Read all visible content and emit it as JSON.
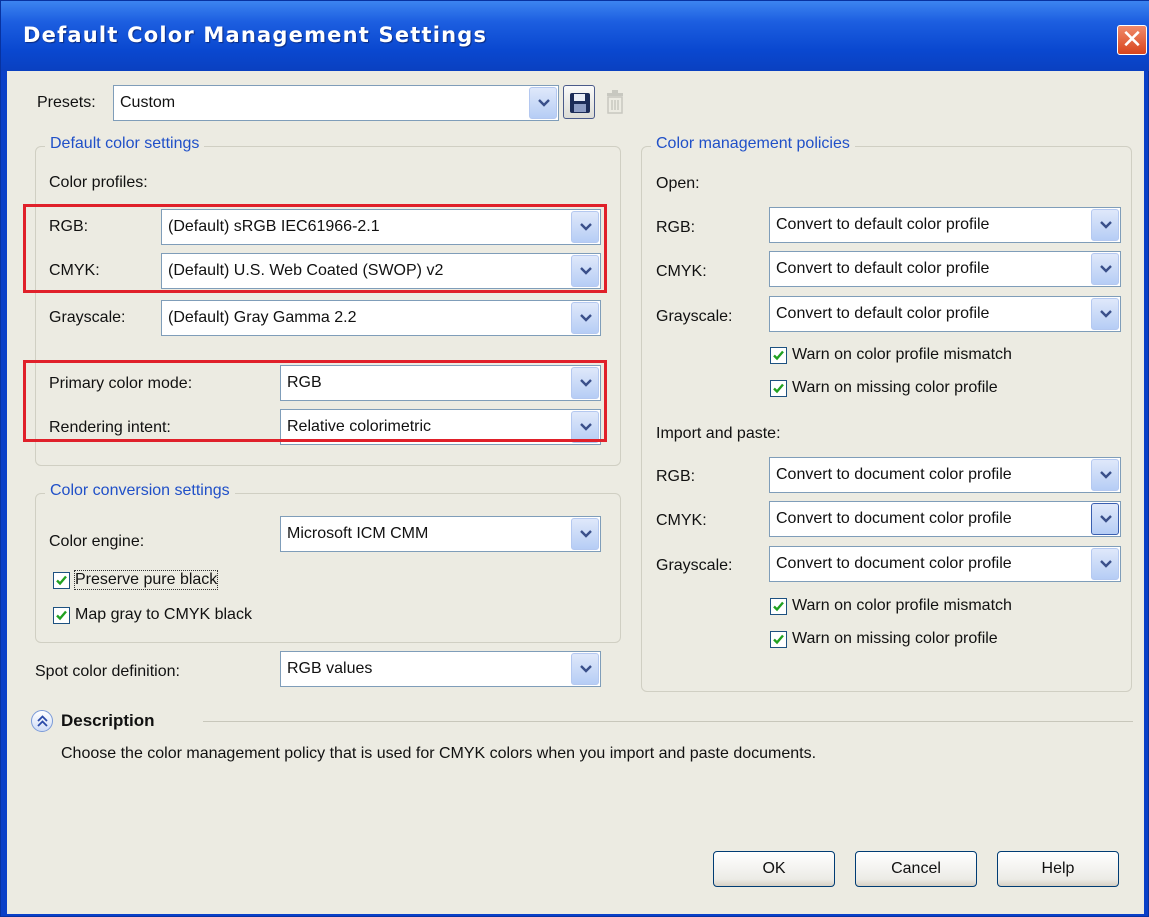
{
  "window": {
    "title": "Default Color Management Settings",
    "close_glyph": "✕"
  },
  "presets": {
    "label": "Presets:",
    "value": "Custom",
    "save_icon": "save-icon",
    "delete_icon": "trash-icon"
  },
  "default_color": {
    "legend": "Default color settings",
    "profiles_label": "Color profiles:",
    "rgb_label": "RGB:",
    "rgb_value": "(Default) sRGB IEC61966-2.1",
    "cmyk_label": "CMYK:",
    "cmyk_value": "(Default) U.S. Web Coated (SWOP) v2",
    "gray_label": "Grayscale:",
    "gray_value": "(Default) Gray Gamma 2.2",
    "mode_label": "Primary color mode:",
    "mode_value": "RGB",
    "intent_label": "Rendering intent:",
    "intent_value": "Relative colorimetric"
  },
  "conversion": {
    "legend": "Color conversion settings",
    "engine_label": "Color engine:",
    "engine_value": "Microsoft ICM CMM",
    "preserve_black": "Preserve pure black",
    "preserve_black_checked": true,
    "map_gray": "Map gray to CMYK black",
    "map_gray_checked": true
  },
  "spot": {
    "label": "Spot color definition:",
    "value": "RGB values"
  },
  "policies": {
    "legend": "Color management policies",
    "open_label": "Open:",
    "open_rgb_label": "RGB:",
    "open_rgb_value": "Convert to default color profile",
    "open_cmyk_label": "CMYK:",
    "open_cmyk_value": "Convert to default color profile",
    "open_gray_label": "Grayscale:",
    "open_gray_value": "Convert to default color profile",
    "open_warn_mismatch": "Warn on color profile mismatch",
    "open_warn_missing": "Warn on missing color profile",
    "import_label": "Import and paste:",
    "imp_rgb_label": "RGB:",
    "imp_rgb_value": "Convert to document color profile",
    "imp_cmyk_label": "CMYK:",
    "imp_cmyk_value": "Convert to document color profile",
    "imp_gray_label": "Grayscale:",
    "imp_gray_value": "Convert to document color profile",
    "imp_warn_mismatch": "Warn on color profile mismatch",
    "imp_warn_missing": "Warn on missing color profile"
  },
  "description": {
    "title": "Description",
    "text": "Choose the color management policy that is used for CMYK colors when you import and paste documents."
  },
  "buttons": {
    "ok": "OK",
    "cancel": "Cancel",
    "help": "Help"
  },
  "colors": {
    "title_blue": "#0a48d0",
    "dialog_bg": "#ecebe2",
    "legend_blue": "#2050c8",
    "highlight_red": "#e0202a",
    "check_green": "#21a121"
  }
}
